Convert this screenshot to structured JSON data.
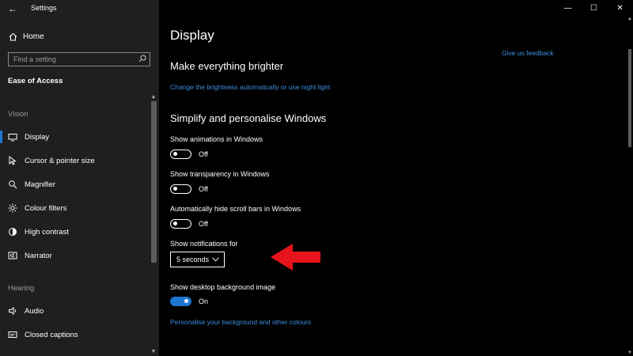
{
  "window": {
    "title": "Settings",
    "controls": {
      "minimize": "—",
      "maximize": "☐",
      "close": "✕"
    }
  },
  "sidebar": {
    "home_label": "Home",
    "search": {
      "placeholder": "Find a setting"
    },
    "section_title": "Ease of Access",
    "groups": [
      {
        "label": "Vision",
        "items": [
          {
            "label": "Display",
            "icon": "monitor-icon",
            "active": true
          },
          {
            "label": "Cursor & pointer size",
            "icon": "cursor-icon"
          },
          {
            "label": "Magnifier",
            "icon": "magnifier-icon"
          },
          {
            "label": "Colour filters",
            "icon": "sun-icon"
          },
          {
            "label": "High contrast",
            "icon": "contrast-icon"
          },
          {
            "label": "Narrator",
            "icon": "narrator-icon"
          }
        ]
      },
      {
        "label": "Hearing",
        "items": [
          {
            "label": "Audio",
            "icon": "speaker-icon"
          },
          {
            "label": "Closed captions",
            "icon": "captions-icon"
          }
        ]
      }
    ]
  },
  "main": {
    "page_title": "Display",
    "feedback_link": "Give us feedback",
    "section1": {
      "heading": "Make everything brighter",
      "link": "Change the brightness automatically or use night light"
    },
    "section2": {
      "heading": "Simplify and personalise Windows",
      "settings": [
        {
          "label": "Show animations in Windows",
          "state": "Off",
          "on": false
        },
        {
          "label": "Show transparency in Windows",
          "state": "Off",
          "on": false
        },
        {
          "label": "Automatically hide scroll bars in Windows",
          "state": "Off",
          "on": false
        }
      ],
      "notifications": {
        "label": "Show notifications for",
        "value": "5 seconds"
      },
      "background": {
        "label": "Show desktop background image",
        "state": "On",
        "on": true
      },
      "link": "Personalise your background and other colours"
    }
  },
  "colors": {
    "accent": "#1d77d2",
    "link": "#3b8fe0",
    "sidebar_bg": "#1f1f1f",
    "main_bg": "#000000",
    "annotation_arrow": "#e8141c"
  }
}
